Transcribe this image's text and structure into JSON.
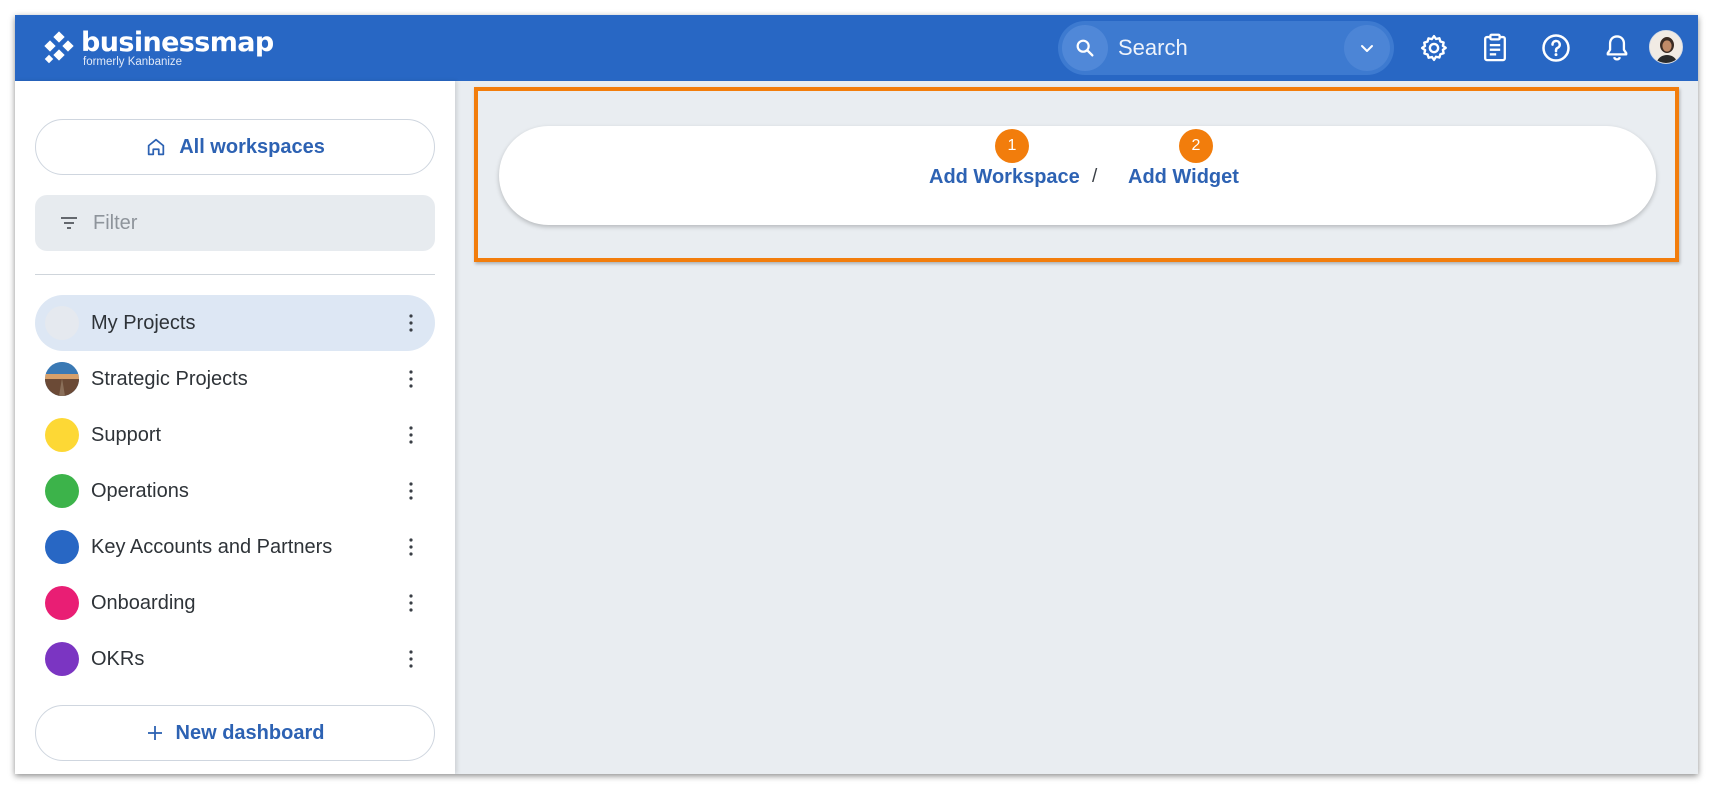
{
  "topbar": {
    "logo_name": "businessmap",
    "logo_sub": "formerly Kanbanize",
    "search_placeholder": "Search",
    "icons": [
      "search-icon",
      "chevron-down-icon",
      "gear-icon",
      "clipboard-icon",
      "help-icon",
      "bell-icon",
      "avatar"
    ]
  },
  "sidebar": {
    "all_workspaces": "All workspaces",
    "filter_placeholder": "Filter",
    "workspaces": [
      {
        "label": "My Projects",
        "color": "#e5e9ef",
        "active": true
      },
      {
        "label": "Strategic Projects",
        "color": "image",
        "active": false
      },
      {
        "label": "Support",
        "color": "#fdd835",
        "active": false
      },
      {
        "label": "Operations",
        "color": "#3cb34a",
        "active": false
      },
      {
        "label": "Key Accounts and Partners",
        "color": "#2867c4",
        "active": false
      },
      {
        "label": "Onboarding",
        "color": "#e91e74",
        "active": false
      },
      {
        "label": "OKRs",
        "color": "#7b35c2",
        "active": false
      }
    ],
    "new_dashboard": "New dashboard"
  },
  "main": {
    "add_workspace": "Add Workspace",
    "separator": "/",
    "add_widget": "Add Widget",
    "step1": "1",
    "step2": "2"
  },
  "colors": {
    "brand_blue": "#2867c4",
    "link_blue": "#2d62b3",
    "highlight_orange": "#f27d0c",
    "canvas": "#e9edf1"
  }
}
